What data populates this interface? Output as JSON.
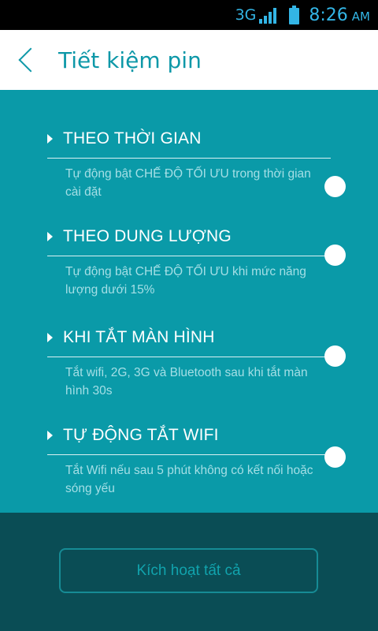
{
  "status_bar": {
    "network": "3G",
    "time": "8:26",
    "ampm": "AM",
    "accent_color": "#33b5e5"
  },
  "header": {
    "back_icon": "chevron-left-icon",
    "title": "Tiết kiệm pin"
  },
  "sections": [
    {
      "label": "THEO THỜI GIAN",
      "desc": "Tự động bật CHẾ ĐỘ TỐI ƯU trong thời gian cài đặt"
    },
    {
      "label": "THEO DUNG LƯỢNG",
      "desc": "Tự động bật CHẾ ĐỘ TỐI ƯU khi mức năng lượng dưới 15%"
    },
    {
      "label": "KHI TẮT MÀN HÌNH",
      "desc": "Tắt wifi, 2G, 3G và Bluetooth sau khi tắt màn hình 30s"
    },
    {
      "label": "TỰ ĐỘNG TẮT WIFI",
      "desc": "Tắt Wifi nếu sau 5 phút không có kết nối hoặc sóng yếu"
    }
  ],
  "footer": {
    "activate_all": "Kích hoạt tất cả"
  },
  "colors": {
    "content_bg": "#0a9aa8",
    "footer_bg": "#0a4d55",
    "title_color": "#0d98a8"
  }
}
